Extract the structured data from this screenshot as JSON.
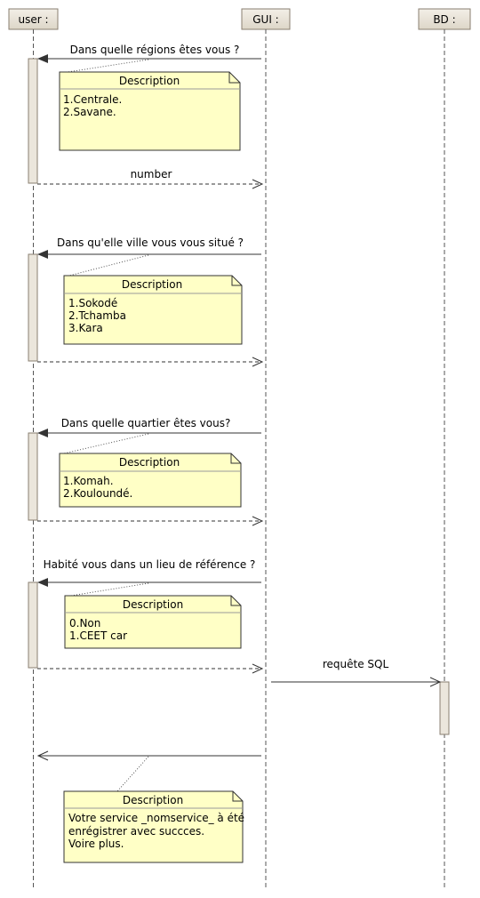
{
  "lifelines": {
    "user": "user :",
    "gui": "GUI :",
    "bd": "BD :"
  },
  "messages": {
    "q1": "Dans quelle régions êtes vous ?",
    "r1": "number",
    "q2": "Dans qu'elle ville vous vous situé ?",
    "q3": "Dans quelle quartier êtes vous?",
    "q4": "Habité vous dans un lieu de référence ?",
    "sql": "requête SQL"
  },
  "notes": [
    {
      "title": "Description",
      "lines": [
        "1.Centrale.",
        "2.Savane."
      ]
    },
    {
      "title": "Description",
      "lines": [
        "1.Sokodé",
        "2.Tchamba",
        "3.Kara"
      ]
    },
    {
      "title": "Description",
      "lines": [
        "1.Komah.",
        "2.Kouloundé."
      ]
    },
    {
      "title": "Description",
      "lines": [
        "0.Non",
        "1.CEET car"
      ]
    },
    {
      "title": "Description",
      "lines": [
        "Votre service _nomservice_ à été",
        "enrégistrer avec succces.",
        "Voire plus."
      ]
    }
  ],
  "colors": {
    "head_fill": "#ebe6dc",
    "activation_fill": "#ebe6dc",
    "note_fill": "#ffffc6",
    "line": "#4a3f35"
  }
}
